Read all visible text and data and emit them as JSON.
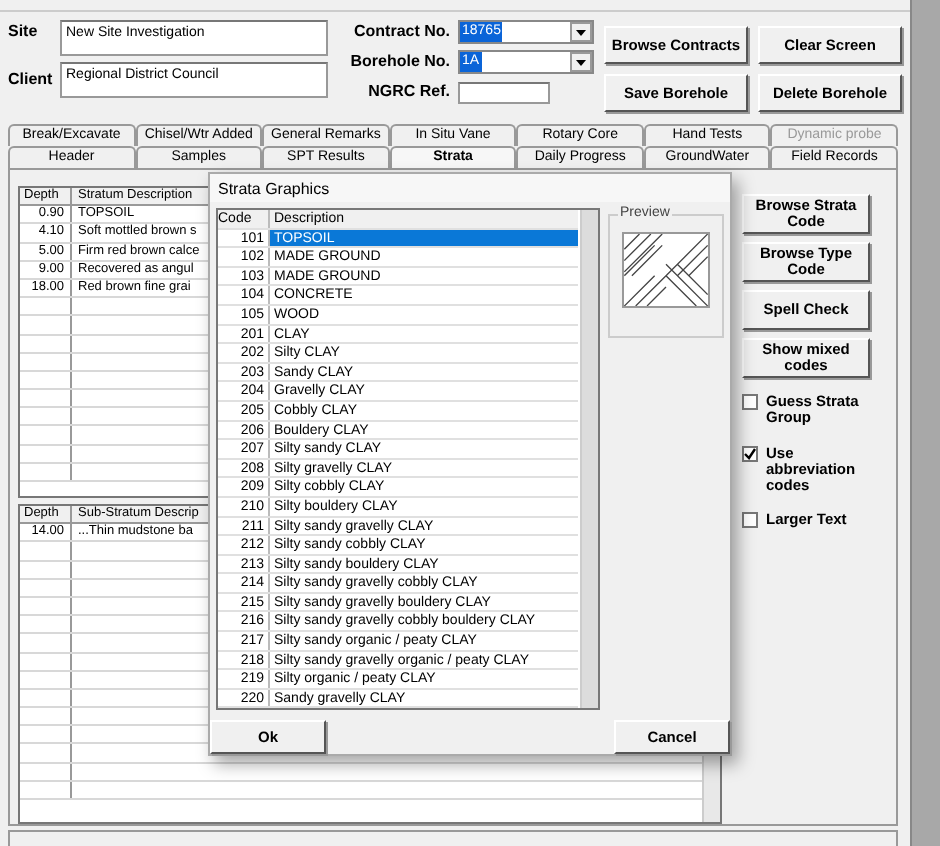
{
  "header": {
    "site_label": "Site",
    "site": "New Site Investigation",
    "client_label": "Client",
    "client": "Regional District Council",
    "contract_label": "Contract No.",
    "contract": "18765",
    "borehole_label": "Borehole No.",
    "borehole": "1A",
    "ngrc_label": "NGRC Ref."
  },
  "header_buttons": [
    "Browse Contracts",
    "Clear Screen",
    "Save Borehole",
    "Delete Borehole"
  ],
  "tabs_back": [
    {
      "label": "Break/Excavate",
      "disabled": false
    },
    {
      "label": "Chisel/Wtr Added",
      "disabled": false
    },
    {
      "label": "General Remarks",
      "disabled": false
    },
    {
      "label": "In Situ Vane",
      "disabled": false
    },
    {
      "label": "Rotary Core",
      "disabled": false
    },
    {
      "label": "Hand Tests",
      "disabled": false
    },
    {
      "label": "Dynamic probe",
      "disabled": true
    }
  ],
  "tabs_front": [
    {
      "label": "Header",
      "selected": false
    },
    {
      "label": "Samples",
      "selected": false
    },
    {
      "label": "SPT Results",
      "selected": false
    },
    {
      "label": "Strata",
      "selected": true
    },
    {
      "label": "Daily Progress",
      "selected": false
    },
    {
      "label": "GroundWater",
      "selected": false
    },
    {
      "label": "Field Records",
      "selected": false
    }
  ],
  "strata_table": {
    "columns": [
      "Depth",
      "Stratum Description"
    ],
    "rows": [
      [
        "0.90",
        "TOPSOIL"
      ],
      [
        "4.10",
        "Soft mottled brown s"
      ],
      [
        "5.00",
        "Firm red brown calce"
      ],
      [
        "9.00",
        "Recovered as angul"
      ],
      [
        "18.00",
        "Red brown fine grai"
      ]
    ]
  },
  "sub_strata_table": {
    "columns": [
      "Depth",
      "Sub-Stratum Descrip"
    ],
    "rows": [
      [
        "14.00",
        "...Thin mudstone ba"
      ]
    ]
  },
  "side_buttons": [
    "Browse Strata Code",
    "Browse Type Code",
    "Spell Check",
    "Show mixed codes"
  ],
  "checkboxes": [
    {
      "label": "Guess Strata Group",
      "checked": false
    },
    {
      "label": "Use abbreviation codes",
      "checked": true
    },
    {
      "label": "Larger Text",
      "checked": false
    }
  ],
  "dialog": {
    "title": "Strata Graphics",
    "columns": [
      "Code",
      "Description"
    ],
    "preview_label": "Preview",
    "buttons": [
      "Ok",
      "Cancel"
    ],
    "rows": [
      {
        "code": "101",
        "description": "TOPSOIL",
        "selected": true
      },
      {
        "code": "102",
        "description": "MADE GROUND",
        "selected": false
      },
      {
        "code": "103",
        "description": "MADE GROUND",
        "selected": false
      },
      {
        "code": "104",
        "description": "CONCRETE",
        "selected": false
      },
      {
        "code": "105",
        "description": "WOOD",
        "selected": false
      },
      {
        "code": "201",
        "description": "CLAY",
        "selected": false
      },
      {
        "code": "202",
        "description": "Silty CLAY",
        "selected": false
      },
      {
        "code": "203",
        "description": "Sandy CLAY",
        "selected": false
      },
      {
        "code": "204",
        "description": "Gravelly CLAY",
        "selected": false
      },
      {
        "code": "205",
        "description": "Cobbly CLAY",
        "selected": false
      },
      {
        "code": "206",
        "description": "Bouldery CLAY",
        "selected": false
      },
      {
        "code": "207",
        "description": "Silty sandy CLAY",
        "selected": false
      },
      {
        "code": "208",
        "description": "Silty gravelly CLAY",
        "selected": false
      },
      {
        "code": "209",
        "description": "Silty cobbly CLAY",
        "selected": false
      },
      {
        "code": "210",
        "description": "Silty bouldery CLAY",
        "selected": false
      },
      {
        "code": "211",
        "description": "Silty sandy gravelly CLAY",
        "selected": false
      },
      {
        "code": "212",
        "description": "Silty sandy cobbly CLAY",
        "selected": false
      },
      {
        "code": "213",
        "description": "Silty sandy bouldery CLAY",
        "selected": false
      },
      {
        "code": "214",
        "description": "Silty sandy gravelly cobbly CLAY",
        "selected": false
      },
      {
        "code": "215",
        "description": "Silty sandy gravelly bouldery CLAY",
        "selected": false
      },
      {
        "code": "216",
        "description": "Silty sandy gravelly cobbly bouldery CLAY",
        "selected": false
      },
      {
        "code": "217",
        "description": "Silty sandy organic / peaty CLAY",
        "selected": false
      },
      {
        "code": "218",
        "description": "Silty sandy gravelly organic / peaty CLAY",
        "selected": false
      },
      {
        "code": "219",
        "description": "Silty organic / peaty CLAY",
        "selected": false
      },
      {
        "code": "220",
        "description": "Sandy gravelly CLAY",
        "selected": false
      }
    ]
  }
}
